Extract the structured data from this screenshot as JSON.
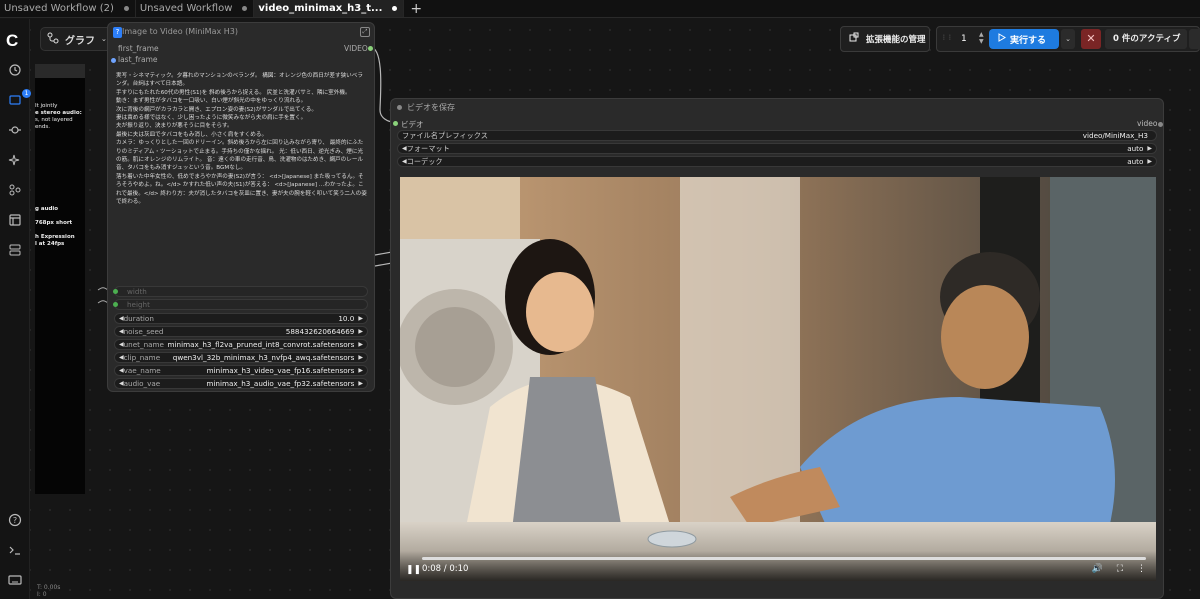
{
  "tabs": [
    {
      "label": "Unsaved Workflow (2)",
      "active": false
    },
    {
      "label": "Unsaved Workflow",
      "active": false
    },
    {
      "label": "video_minimax_h3_t...",
      "active": true
    }
  ],
  "tab_add": "+",
  "sidebar": {
    "queue_badge": "1"
  },
  "graph_button": {
    "label": "グラフ"
  },
  "toolbar": {
    "extensions_label": "拡張機能の管理",
    "run_count": "1",
    "run_label": "実行する",
    "active_label": "0 件のアクティブ"
  },
  "left_panel": {
    "lines": [
      {
        "text": "It jointly",
        "bold": false
      },
      {
        "text": "e stereo audio:",
        "bold": true
      },
      {
        "text": "s, not layered",
        "bold": false
      },
      {
        "text": "ends.",
        "bold": false
      },
      {
        "text": "g audio",
        "bold": true
      },
      {
        "text": "768px short",
        "bold": true
      },
      {
        "text": "h Expression",
        "bold": true
      },
      {
        "text": "l at 24fps",
        "bold": true
      }
    ],
    "stats": [
      "T: 0.00s",
      "I: 0"
    ]
  },
  "node_i2v": {
    "title": "Image to Video (MiniMax H3)",
    "marker": "?",
    "inputs": [
      "first_frame",
      "last_frame"
    ],
    "output": "VIDEO",
    "prompt_lines": [
      "実写・シネマティック。夕暮れのマンションのベランダ。 構図：オレンジ色の西日が差す狭いベランダ。台詞はすべて日本語。",
      "手すりにもたれた60代の男性(S1)を 斜め後ろから捉える。 尻並と洗濯バサミ、隣に室外機。",
      "動き：まず男性がタバコを一口吸い、白い煙が斜光の中をゆっくり流れる。",
      "次に背後の網戸がカラカラと開き、エプロン姿の妻(S2)がサンダルで出てくる。",
      "妻は責める様ではなく、少し困ったように微笑みながら夫の肩に手を置く。",
      "夫が振り返り、決まりが悪そうに目をそらす。",
      "最後に夫は灰皿でタバコをもみ消し、小さく肩をすくめる。",
      "カメラ：ゆっくりとした一回のドリーイン。斜め後ろから左に回り込みながら寄り、 最終的にふたりのミディアム・ツーショットで止まる。手持ちの僅かな揺れ。 光：低い西日、逆光ぎみ、煙に光の筋。肌にオレンジのリムライト。 音：遠くの車の走行音、鳥、洗濯物のはためき、網戸のレール音、タバコをもみ消すジュッという音。BGMなし。",
      "落ち着いた中年女性の、低めでまろやか声の妻(S2)が言う： <d>[Japanese] また吸ってるん。そろそろやめよ。ね。</d> かすれた低い声の夫(S1)が答える： <d>[Japanese] …わかったよ。これで最後。</d> 終わり方：夫が消したタバコを灰皿に置き、妻が夫の腕を軽く叩いて笑う二人の姿で終わる。"
    ],
    "widgets": [
      {
        "label": "width",
        "value": "",
        "disabled": true
      },
      {
        "label": "height",
        "value": "",
        "disabled": true
      },
      {
        "label": "duration",
        "value": "10.0",
        "disabled": false
      },
      {
        "label": "noise_seed",
        "value": "588432620664669",
        "disabled": false
      },
      {
        "label": "unet_name",
        "value": "minimax_h3_fl2va_pruned_int8_convrot.safetensors",
        "disabled": false
      },
      {
        "label": "clip_name",
        "value": "qwen3vl_32b_minimax_h3_nvfp4_awq.safetensors",
        "disabled": false
      },
      {
        "label": "vae_name",
        "value": "minimax_h3_video_vae_fp16.safetensors",
        "disabled": false
      },
      {
        "label": "audio_vae",
        "value": "minimax_h3_audio_vae_fp32.safetensors",
        "disabled": false
      }
    ]
  },
  "node_save": {
    "title": "ビデオを保存",
    "input": "ビデオ",
    "output": "video",
    "widgets": [
      {
        "label": "ファイル名プレフィックス",
        "value": "video/MiniMax_H3",
        "arrows": false
      },
      {
        "label": "フォーマット",
        "value": "auto",
        "arrows": true
      },
      {
        "label": "コーデック",
        "value": "auto",
        "arrows": true
      }
    ]
  },
  "video_player": {
    "time": "0:08 / 0:10",
    "progress": 0.8
  },
  "colors": {
    "accent": "#1e7be0",
    "stop": "#7a2525",
    "node_bg": "#2a2a2a",
    "slot_green": "#4caf50"
  }
}
